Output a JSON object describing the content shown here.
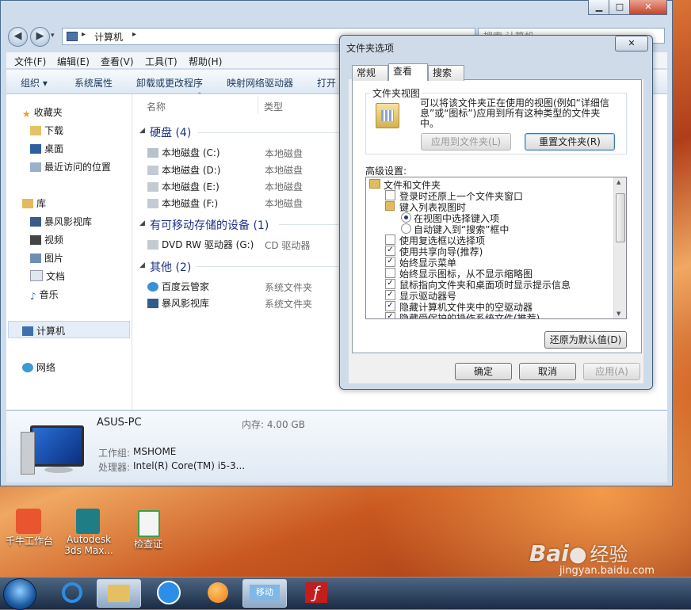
{
  "explorer": {
    "breadcrumb": "计算机",
    "search_placeholder": "搜索 计算机",
    "menus": [
      "文件(F)",
      "编辑(E)",
      "查看(V)",
      "工具(T)",
      "帮助(H)"
    ],
    "toolbar": [
      "组织 ▾",
      "系统属性",
      "卸载或更改程序",
      "映射网络驱动器",
      "打开"
    ],
    "nav": {
      "favorites": "收藏夹",
      "fav_items": [
        "下载",
        "桌面",
        "最近访问的位置"
      ],
      "library": "库",
      "lib_items": [
        "暴风影视库",
        "视频",
        "图片",
        "文档",
        "音乐"
      ],
      "computer": "计算机",
      "network": "网络"
    },
    "columns": {
      "name": "名称",
      "type": "类型"
    },
    "groups": [
      {
        "title": "硬盘 (4)",
        "items": [
          [
            "本地磁盘 (C:)",
            "本地磁盘"
          ],
          [
            "本地磁盘 (D:)",
            "本地磁盘"
          ],
          [
            "本地磁盘 (E:)",
            "本地磁盘"
          ],
          [
            "本地磁盘 (F:)",
            "本地磁盘"
          ]
        ]
      },
      {
        "title": "有可移动存储的设备 (1)",
        "items": [
          [
            "DVD RW 驱动器 (G:)",
            "CD 驱动器"
          ]
        ]
      },
      {
        "title": "其他 (2)",
        "items": [
          [
            "百度云管家",
            "系统文件夹"
          ],
          [
            "暴风影视库",
            "系统文件夹"
          ]
        ]
      }
    ],
    "details": {
      "pc_name": "ASUS-PC",
      "memory": "内存: 4.00 GB",
      "workgroup_label": "工作组:",
      "workgroup": "MSHOME",
      "cpu_label": "处理器:",
      "cpu": "Intel(R) Core(TM) i5-3..."
    }
  },
  "dialog": {
    "title": "文件夹选项",
    "close": "✕",
    "tabs": [
      "常规",
      "查看",
      "搜索"
    ],
    "active_tab": "查看",
    "folder_view_legend": "文件夹视图",
    "folder_view_desc": "可以将该文件夹正在使用的视图(例如“详细信息”或“图标”)应用到所有这种类型的文件夹中。",
    "apply_to_folders": "应用到文件夹(L)",
    "reset_folders": "重置文件夹(R)",
    "advanced_label": "高级设置:",
    "tree": [
      {
        "text": "文件和文件夹",
        "kind": "folder"
      },
      {
        "text": "登录时还原上一个文件夹窗口",
        "kind": "check",
        "checked": false
      },
      {
        "text": "键入列表视图时",
        "kind": "folder2"
      },
      {
        "text": "在视图中选择键入项",
        "kind": "radio",
        "checked": true
      },
      {
        "text": "自动键入到“搜索”框中",
        "kind": "radio",
        "checked": false
      },
      {
        "text": "使用复选框以选择项",
        "kind": "check",
        "checked": false
      },
      {
        "text": "使用共享向导(推荐)",
        "kind": "check",
        "checked": true
      },
      {
        "text": "始终显示菜单",
        "kind": "check",
        "checked": true
      },
      {
        "text": "始终显示图标，从不显示缩略图",
        "kind": "check",
        "checked": false
      },
      {
        "text": "鼠标指向文件夹和桌面项时显示提示信息",
        "kind": "check",
        "checked": true
      },
      {
        "text": "显示驱动器号",
        "kind": "check",
        "checked": true
      },
      {
        "text": "隐藏计算机文件夹中的空驱动器",
        "kind": "check",
        "checked": true
      },
      {
        "text": "隐藏受保护的操作系统文件(推荐)",
        "kind": "check",
        "checked": true
      }
    ],
    "restore_defaults": "还原为默认值(D)",
    "ok": "确定",
    "cancel": "取消",
    "apply": "应用(A)"
  },
  "desktop": {
    "icons": [
      "千牛工作台",
      "Autodesk 3ds Max...",
      "检查证"
    ]
  },
  "taskbar": {
    "items": [
      "start-orb",
      "internet-explorer",
      "windows-explorer",
      "sogou",
      "orange-app",
      "mobile-app",
      "flash"
    ],
    "mobile_label": "移动"
  },
  "watermark": {
    "brand": "Bai",
    "brand2": "经验",
    "url": "jingyan.baidu.com"
  },
  "colors": {
    "accent": "#1e3287",
    "titlebar": "#cfdceb",
    "taskbar": "#1b2c44"
  }
}
